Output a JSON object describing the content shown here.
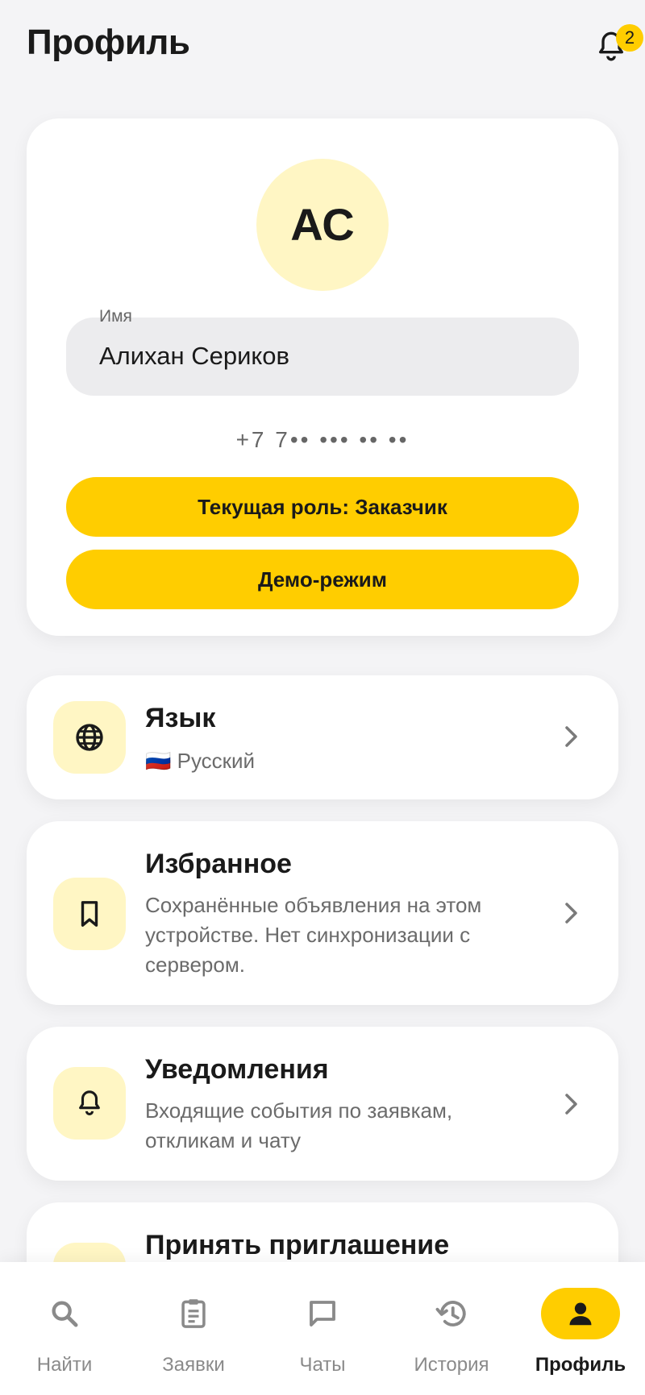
{
  "header": {
    "title": "Профиль",
    "notification_count": "2"
  },
  "profile": {
    "avatar_initials": "АС",
    "name_label": "Имя",
    "name_value": "Алихан Сериков",
    "phone_masked": "+7 7•• ••• •• ••",
    "role_button": "Текущая роль: Заказчик",
    "demo_button": "Демо-режим"
  },
  "menu": {
    "language": {
      "title": "Язык",
      "flag": "🇷🇺",
      "value": "Русский",
      "icon": "globe-icon"
    },
    "favorites": {
      "title": "Избранное",
      "subtitle": "Сохранённые объявления на этом устройстве. Нет синхронизации с сервером.",
      "icon": "bookmark-icon"
    },
    "notifications": {
      "title": "Уведомления",
      "subtitle": "Входящие события по заявкам, откликам и чату",
      "icon": "bell-icon"
    },
    "invite": {
      "title": "Принять приглашение"
    }
  },
  "nav": [
    {
      "label": "Найти",
      "icon": "search-icon"
    },
    {
      "label": "Заявки",
      "icon": "clipboard-icon"
    },
    {
      "label": "Чаты",
      "icon": "chat-icon"
    },
    {
      "label": "История",
      "icon": "history-icon"
    },
    {
      "label": "Профиль",
      "icon": "person-icon",
      "active": true
    }
  ],
  "colors": {
    "accent": "#ffcd00",
    "icon_bg": "#fff6c4",
    "background": "#f4f4f6"
  }
}
